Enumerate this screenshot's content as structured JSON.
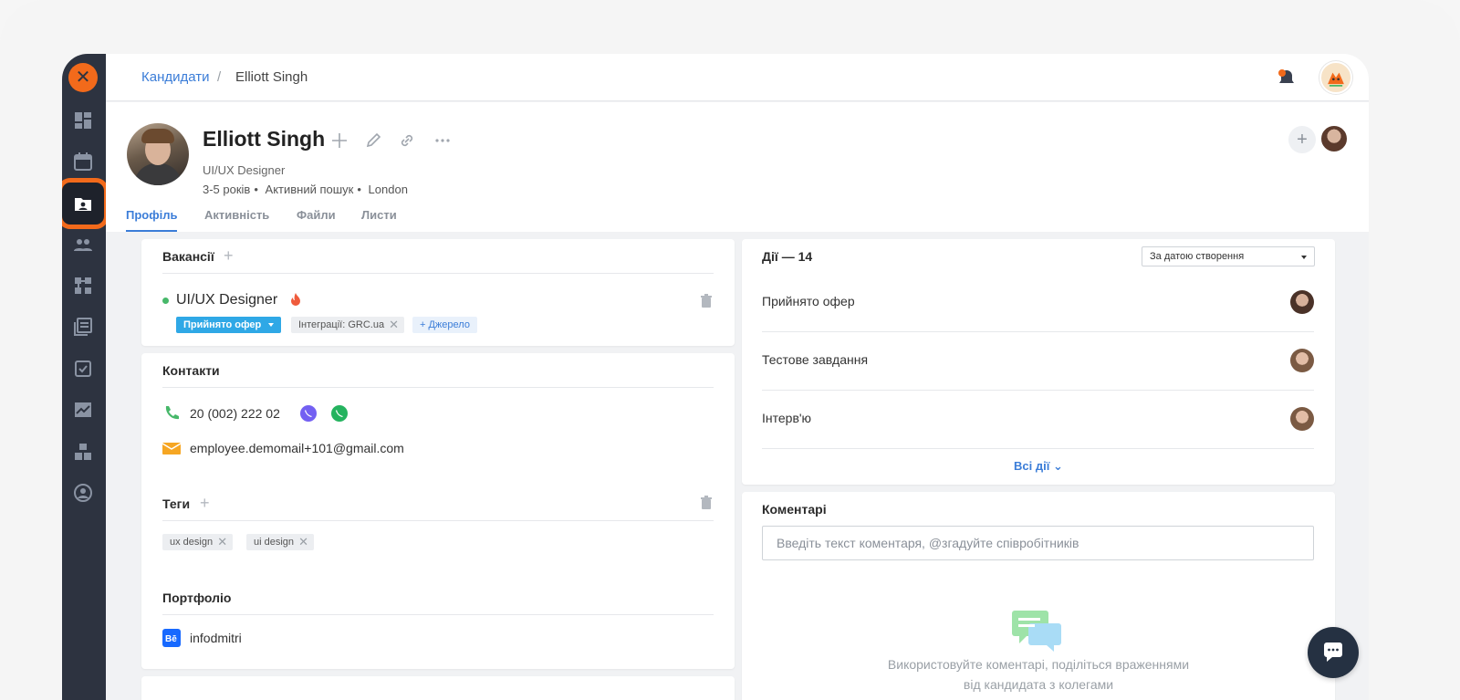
{
  "breadcrumb": {
    "parent": "Кандидати",
    "separator": "/",
    "current": "Elliott Singh"
  },
  "candidate": {
    "name": "Elliott Singh",
    "role": "UI/UX Designer",
    "meta": [
      "3-5 років",
      "Активний пошук",
      "London"
    ]
  },
  "tabs": [
    {
      "label": "Профіль",
      "active": true
    },
    {
      "label": "Активність"
    },
    {
      "label": "Файли"
    },
    {
      "label": "Листи"
    }
  ],
  "vacancies": {
    "title": "Вакансії",
    "item": {
      "title": "UI/UX Designer",
      "status": "Прийнято офер",
      "chip": "Інтеграції: GRC.ua",
      "add_source": "Джерело"
    }
  },
  "contacts": {
    "title": "Контакти",
    "phone": "20 (002) 222 02",
    "email": "employee.demomail+101@gmail.com"
  },
  "tags": {
    "title": "Теги",
    "items": [
      "ux design",
      "ui design"
    ]
  },
  "portfolio": {
    "title": "Портфоліо",
    "behance": "infodmitri"
  },
  "actions": {
    "title": "Дії — 14",
    "sort": "За датою створення",
    "items": [
      "Прийнято офер",
      "Тестове завдання",
      "Інтерв'ю"
    ],
    "all": "Всі дії"
  },
  "comments": {
    "title": "Коментарі",
    "placeholder": "Введіть текст коментаря, @згадуйте співробітників",
    "empty_text": "Використовуйте коментарі, поділіться враженнями від кандидата з колегами"
  },
  "colors": {
    "accent": "#3b7dd8",
    "brand": "#f26a1b",
    "sidebar": "#2d3340",
    "status": "#2fa8e6"
  }
}
